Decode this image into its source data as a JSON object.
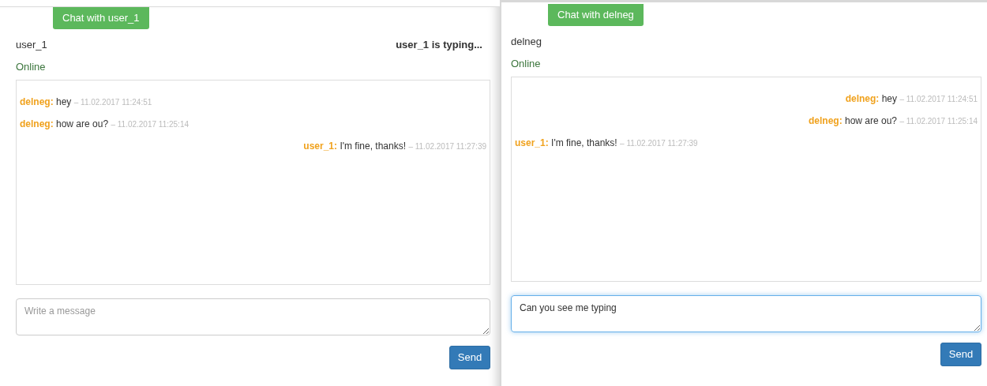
{
  "windows": [
    {
      "chat_button": "Chat with user_1",
      "contact": "user_1",
      "typing": "user_1 is typing...",
      "status": "Online",
      "messages": [
        {
          "kind": "incoming",
          "author": "delneg:",
          "text": "hey",
          "time": "– 11.02.2017 11:24:51"
        },
        {
          "kind": "incoming",
          "author": "delneg:",
          "text": "how are ou?",
          "time": "– 11.02.2017 11:25:14"
        },
        {
          "kind": "outgoing",
          "author": "user_1:",
          "text": "I'm fine, thanks!",
          "time": "– 11.02.2017 11:27:39"
        }
      ],
      "input": {
        "placeholder": "Write a message",
        "focused": false
      },
      "send": "Send"
    },
    {
      "chat_button": "Chat with delneg",
      "contact": "delneg",
      "status": "Online",
      "messages": [
        {
          "kind": "outgoing",
          "author": "delneg:",
          "text": "hey",
          "time": "– 11.02.2017 11:24:51"
        },
        {
          "kind": "outgoing",
          "author": "delneg:",
          "text": "how are ou?",
          "time": "– 11.02.2017 11:25:14"
        },
        {
          "kind": "incoming",
          "author": "user_1:",
          "text": "I'm fine, thanks!",
          "time": "– 11.02.2017 11:27:39"
        }
      ],
      "input": {
        "value": "Can you see me typing",
        "focused": true
      },
      "send": "Send"
    }
  ]
}
